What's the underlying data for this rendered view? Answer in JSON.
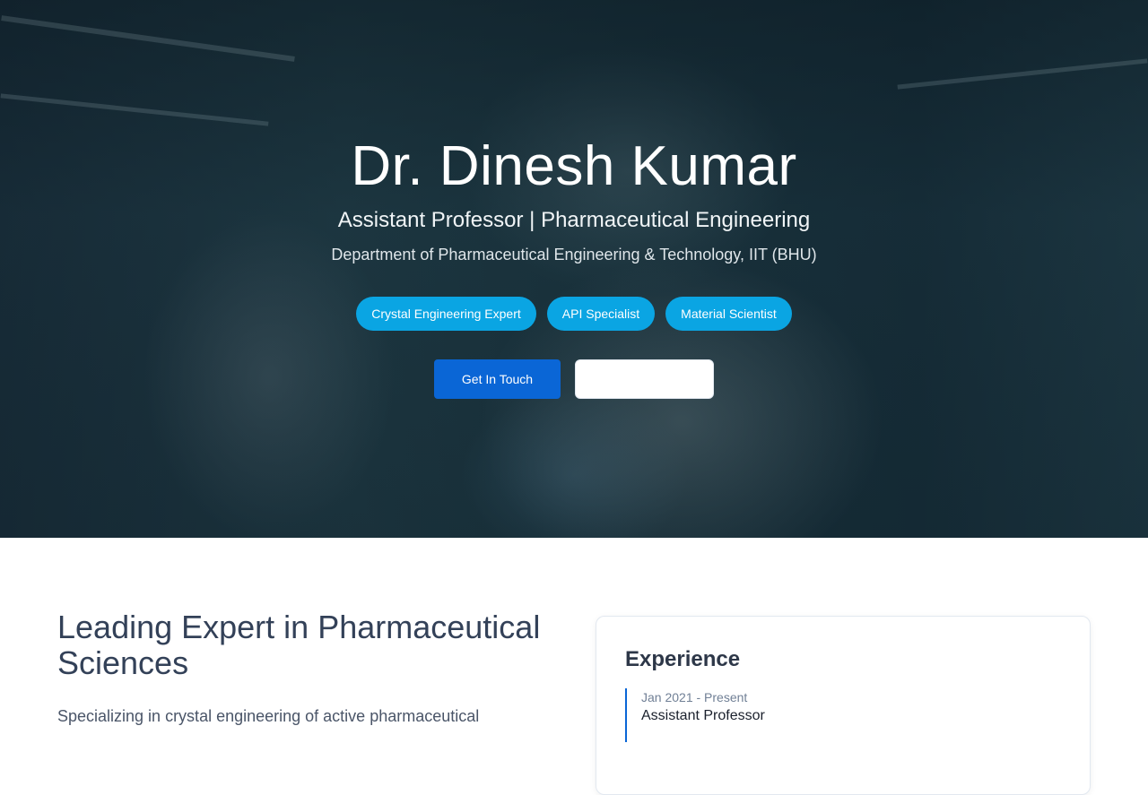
{
  "hero": {
    "name": "Dr. Dinesh Kumar",
    "subtitle": "Assistant Professor | Pharmaceutical Engineering",
    "department": "Department of Pharmaceutical Engineering & Technology, IIT (BHU)",
    "tags": [
      "Crystal Engineering Expert",
      "API Specialist",
      "Material Scientist"
    ],
    "cta_primary": "Get In Touch",
    "cta_secondary": ""
  },
  "about": {
    "heading": "Leading Expert in Pharmaceutical Sciences",
    "intro": "Specializing in crystal engineering of active pharmaceutical"
  },
  "experience": {
    "title": "Experience",
    "items": [
      {
        "date": "Jan 2021 - Present",
        "role": "Assistant Professor"
      }
    ]
  },
  "colors": {
    "tag_bg": "#0aa5e3",
    "primary_button": "#0a66d6",
    "heading_text": "#334158"
  }
}
